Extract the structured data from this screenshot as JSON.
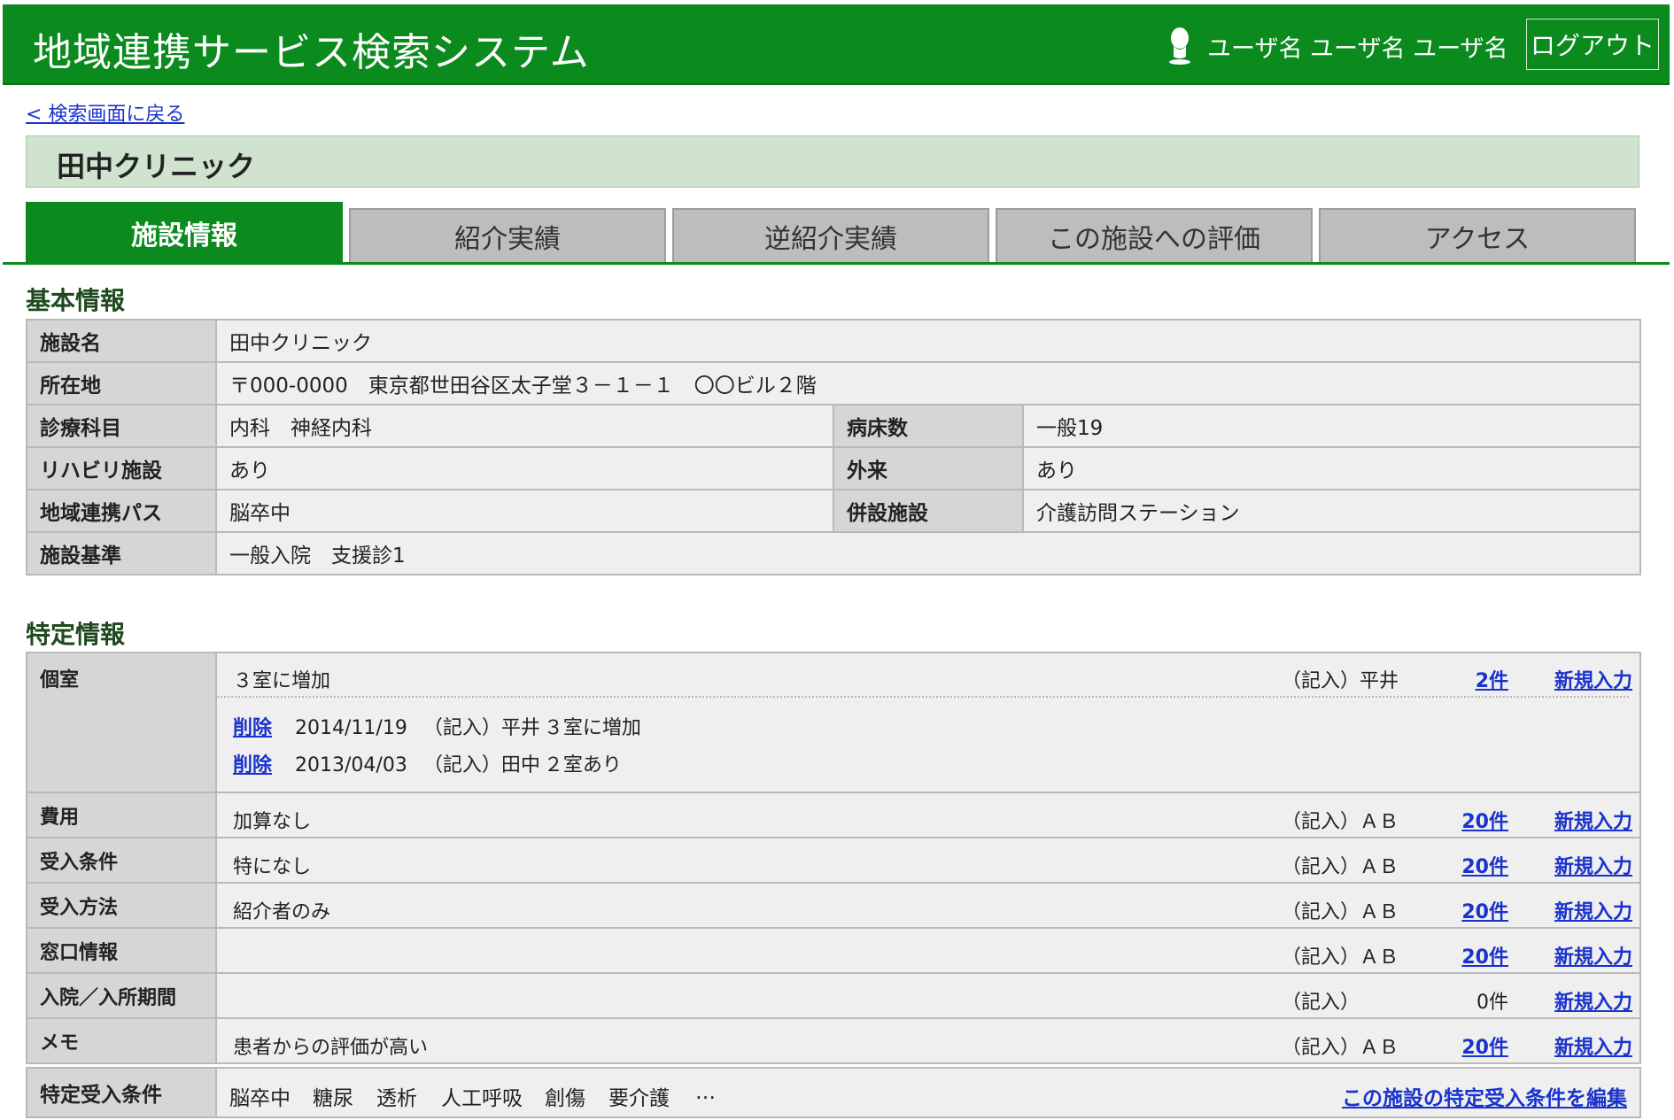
{
  "header": {
    "app_title": "地域連携サービス検索システム",
    "user_name": "ユーザ名 ユーザ名 ユーザ名",
    "logout_label": "ログアウト"
  },
  "back_link": "< 検索画面に戻る",
  "facility_name": "田中クリニック",
  "tabs": [
    {
      "label": "施設情報",
      "active": true
    },
    {
      "label": "紹介実績",
      "active": false
    },
    {
      "label": "逆紹介実績",
      "active": false
    },
    {
      "label": "この施設への評価",
      "active": false
    },
    {
      "label": "アクセス",
      "active": false
    }
  ],
  "basic": {
    "heading": "基本情報",
    "name_label": "施設名",
    "name_value": "田中クリニック",
    "address_label": "所在地",
    "address_value": "〒000-0000　東京都世田谷区太子堂３－１－１　〇〇ビル２階",
    "dept_label": "診療科目",
    "dept_value": "内科　神経内科",
    "beds_label": "病床数",
    "beds_value": "一般19",
    "rehab_label": "リハビリ施設",
    "rehab_value": "あり",
    "outpatient_label": "外来",
    "outpatient_value": "あり",
    "path_label": "地域連携パス",
    "path_value": "脳卒中",
    "annex_label": "併設施設",
    "annex_value": "介護訪問ステーション",
    "standard_label": "施設基準",
    "standard_value": "一般入院　支援診1"
  },
  "specific": {
    "heading": "特定情報",
    "private_room": {
      "label": "個室",
      "value": "３室に増加",
      "kinyu": "（記入）平井",
      "count": "2件",
      "new_label": "新規入力",
      "history": [
        {
          "delete": "削除",
          "date": "2014/11/19",
          "who": "（記入）平井",
          "note": "３室に増加"
        },
        {
          "delete": "削除",
          "date": "2013/04/03",
          "who": "（記入）田中",
          "note": "２室あり"
        }
      ]
    },
    "rows": [
      {
        "label": "費用",
        "value": "加算なし",
        "kinyu": "（記入）ＡＢ",
        "count": "20件",
        "linked": true,
        "new_label": "新規入力"
      },
      {
        "label": "受入条件",
        "value": "特になし",
        "kinyu": "（記入）ＡＢ",
        "count": "20件",
        "linked": true,
        "new_label": "新規入力"
      },
      {
        "label": "受入方法",
        "value": "紹介者のみ",
        "kinyu": "（記入）ＡＢ",
        "count": "20件",
        "linked": true,
        "new_label": "新規入力"
      },
      {
        "label": "窓口情報",
        "value": "",
        "kinyu": "（記入）ＡＢ",
        "count": "20件",
        "linked": true,
        "new_label": "新規入力"
      },
      {
        "label": "入院／入所期間",
        "value": "",
        "kinyu": "（記入）",
        "count": "0件",
        "linked": false,
        "new_label": "新規入力"
      },
      {
        "label": "メモ",
        "value": "患者からの評価が高い",
        "kinyu": "（記入）ＡＢ",
        "count": "20件",
        "linked": true,
        "new_label": "新規入力"
      }
    ]
  },
  "conditions": {
    "label": "特定受入条件",
    "items": [
      "脳卒中",
      "糖尿",
      "透析",
      "人工呼吸",
      "創傷",
      "要介護",
      "…"
    ],
    "edit_label": "この施設の特定受入条件を編集"
  }
}
